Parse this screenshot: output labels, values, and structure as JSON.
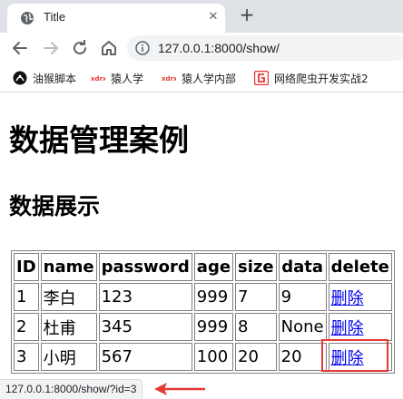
{
  "tab": {
    "title": "Title",
    "close": "✕",
    "new_tab": "+"
  },
  "toolbar": {
    "url": "127.0.0.1:8000/show/"
  },
  "bookmarks": [
    {
      "label": "油猴脚本",
      "icon": "tampermonkey-icon"
    },
    {
      "label": "猿人学",
      "icon": "yuanrenxue-icon"
    },
    {
      "label": "猿人学内部",
      "icon": "yuanrenxue-icon"
    },
    {
      "label": "网络爬虫开发实战2",
      "icon": "crawler-book-icon"
    }
  ],
  "page": {
    "heading": "数据管理案例",
    "subheading": "数据展示",
    "table": {
      "headers": [
        "ID",
        "name",
        "password",
        "age",
        "size",
        "data",
        "delete"
      ],
      "rows": [
        [
          "1",
          "李白",
          "123",
          "999",
          "7",
          "9",
          "删除"
        ],
        [
          "2",
          "杜甫",
          "345",
          "999",
          "8",
          "None",
          "删除"
        ],
        [
          "3",
          "小明",
          "567",
          "100",
          "20",
          "20",
          "删除"
        ]
      ]
    }
  },
  "status": {
    "url": "127.0.0.1:8000/show/?id=3"
  },
  "colors": {
    "link": "#0000ee",
    "highlight": "#e53935",
    "arrow": "#e53935",
    "tabstrip": "#dee1e6"
  }
}
